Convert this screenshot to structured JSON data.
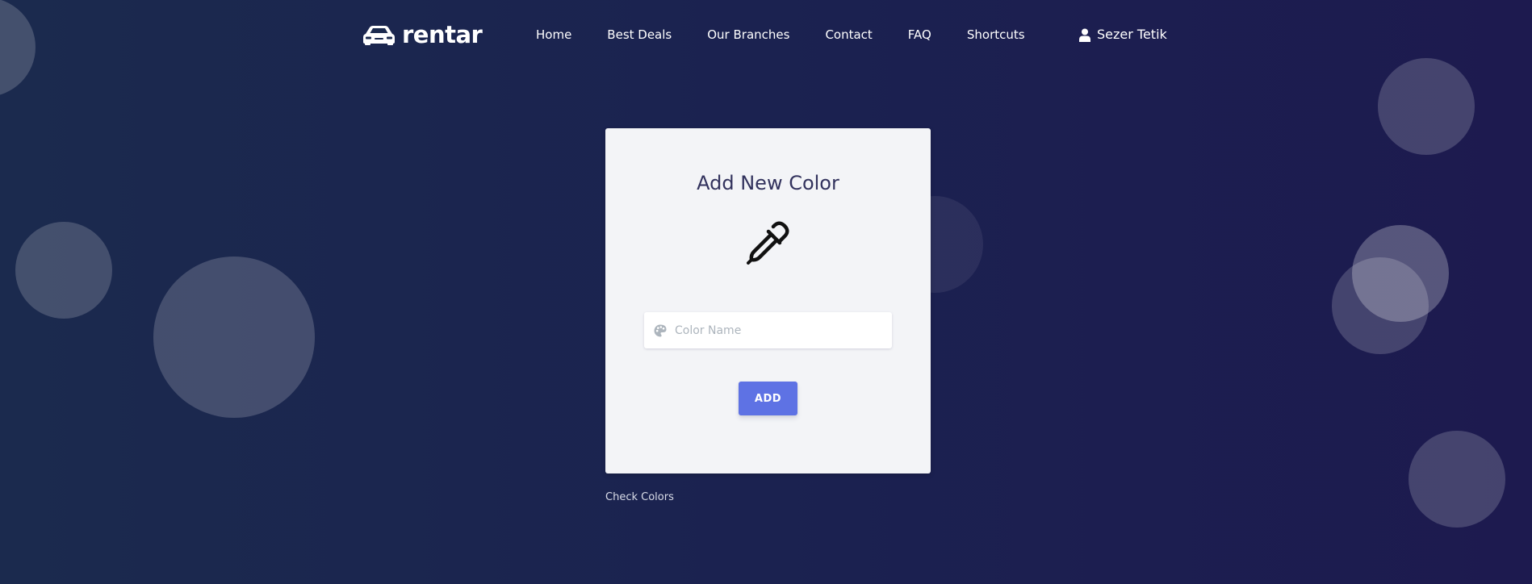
{
  "brand": {
    "name": "rentar",
    "icon": "car-icon"
  },
  "nav": {
    "items": [
      {
        "label": "Home"
      },
      {
        "label": "Best Deals"
      },
      {
        "label": "Our Branches"
      },
      {
        "label": "Contact"
      },
      {
        "label": "FAQ"
      },
      {
        "label": "Shortcuts"
      }
    ]
  },
  "user": {
    "name": "Sezer Tetik",
    "icon": "user-icon"
  },
  "form": {
    "title": "Add New Color",
    "icon": "eyedropper-icon",
    "color_name": {
      "placeholder": "Color Name",
      "value": "",
      "icon": "palette-icon"
    },
    "submit_label": "ADD"
  },
  "footer": {
    "link_label": "Check Colors"
  },
  "theme": {
    "background_start": "#1b2a4e",
    "background_end": "#1d1a4f",
    "card_background": "#f3f4f7",
    "accent": "#5e72e4",
    "title_color": "#32325d"
  }
}
